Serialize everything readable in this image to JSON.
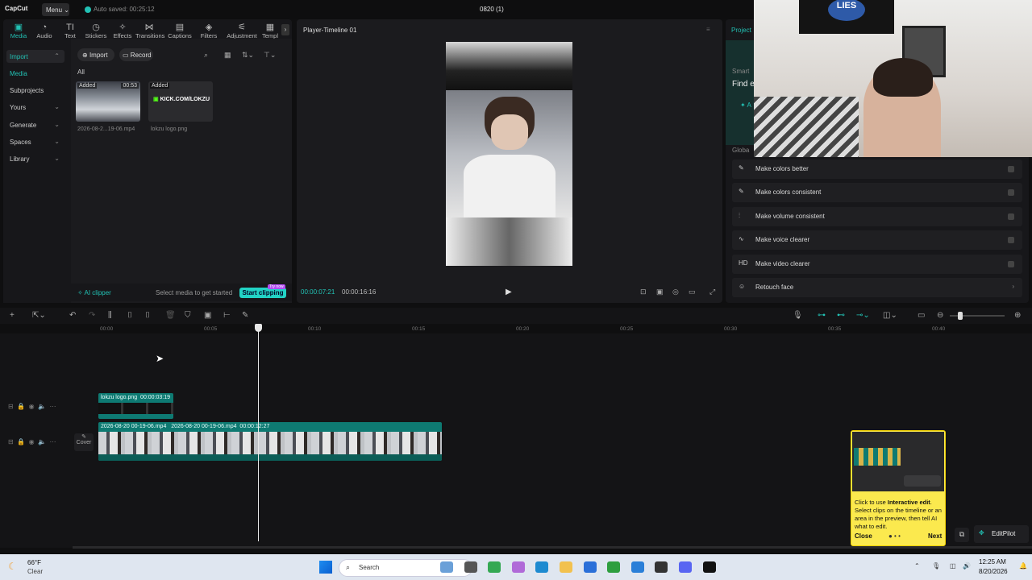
{
  "titlebar": {
    "logo": "CapCut",
    "menu": "Menu",
    "autosave": "Auto saved: 00:25:12",
    "project": "0820 (1)"
  },
  "toolbar": {
    "tabs": [
      {
        "label": "Media",
        "icon": "▣"
      },
      {
        "label": "Audio",
        "icon": "◔"
      },
      {
        "label": "Text",
        "icon": "TI"
      },
      {
        "label": "Stickers",
        "icon": "◷"
      },
      {
        "label": "Effects",
        "icon": "✧"
      },
      {
        "label": "Transitions",
        "icon": "⋈"
      },
      {
        "label": "Captions",
        "icon": "▤"
      },
      {
        "label": "Filters",
        "icon": "◈"
      },
      {
        "label": "Adjustment",
        "icon": "⚟"
      },
      {
        "label": "Templ",
        "icon": "▦"
      }
    ]
  },
  "sidenav": {
    "items": [
      "Import",
      "Media",
      "Subprojects",
      "Yours",
      "Generate",
      "Spaces",
      "Library"
    ]
  },
  "media": {
    "import": "Import",
    "record": "Record",
    "filter_all": "All",
    "items": [
      {
        "added": "Added",
        "duration": "00:53",
        "name": "2026-08-2...19-06.mp4"
      },
      {
        "added": "Added",
        "logo_text": "KICK.COM/LOKZU",
        "name": "lokzu logo.png"
      }
    ]
  },
  "aiclip": {
    "label": "AI clipper",
    "hint": "Select media to get started",
    "button": "Start clipping",
    "badge": "Try now"
  },
  "player": {
    "title": "Player-Timeline 01",
    "current": "00:00:07:21",
    "duration": "00:00:16:16"
  },
  "right": {
    "tab": "Project",
    "smart": "Smart",
    "find": "Find e",
    "global": "Globa",
    "features": [
      {
        "icon": "✎",
        "label": "Make colors better"
      },
      {
        "icon": "✎",
        "label": "Make colors consistent"
      },
      {
        "icon": "⫶",
        "label": "Make volume consistent"
      },
      {
        "icon": "∿",
        "label": "Make voice clearer"
      },
      {
        "icon": "HD",
        "label": "Make video clearer"
      },
      {
        "icon": "☺",
        "label": "Retouch face"
      }
    ]
  },
  "webcam": {
    "poster": "LIES"
  },
  "timeline": {
    "ticks": [
      "00:00",
      "00:05",
      "00:10",
      "00:15",
      "00:20",
      "00:25",
      "00:30",
      "00:35",
      "00:40"
    ],
    "clip_logo": {
      "name": "lokzu logo.png",
      "dur": "00:00:03:19"
    },
    "clip_video": {
      "name1": "2026-08-20 00-19-06.mp4",
      "name2": "2026-08-20 00-19-06.mp4",
      "dur": "00:00:12:27"
    },
    "cover": "Cover"
  },
  "tip": {
    "pre": "Click to use ",
    "bold": "Interactive edit",
    "rest": ". Select clips on the timeline or an area in the preview, then tell AI what to edit.",
    "close": "Close",
    "next": "Next"
  },
  "editpilot": "EditPilot",
  "taskbar": {
    "temp": "66°F",
    "weather": "Clear",
    "search": "Search",
    "time": "12:25 AM",
    "date": "8/20/2026"
  }
}
